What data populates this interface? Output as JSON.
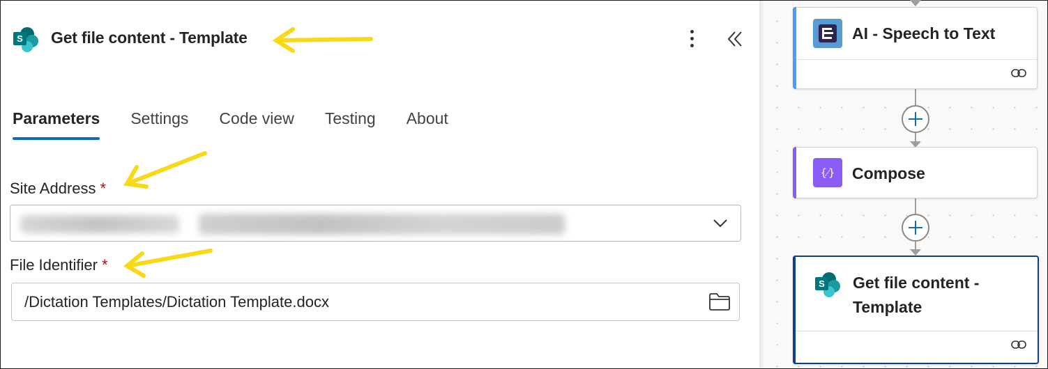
{
  "panel": {
    "title": "Get file content - Template",
    "icon": "sharepoint-icon",
    "more_icon": "more-vertical-icon",
    "collapse_icon": "double-chevron-left-icon"
  },
  "tabs": [
    {
      "label": "Parameters",
      "active": true
    },
    {
      "label": "Settings",
      "active": false
    },
    {
      "label": "Code view",
      "active": false
    },
    {
      "label": "Testing",
      "active": false
    },
    {
      "label": "About",
      "active": false
    }
  ],
  "fields": {
    "site_address": {
      "label": "Site Address",
      "required_mark": "*",
      "value": "",
      "value_blurred": true,
      "icon": "chevron-down-icon"
    },
    "file_identifier": {
      "label": "File Identifier",
      "required_mark": "*",
      "value": "/Dictation Templates/Dictation Template.docx",
      "icon": "folder-icon"
    }
  },
  "flow": {
    "cards": [
      {
        "title": "AI - Speech to Text",
        "icon": "ai-builder-icon",
        "accent": "#4a9ff5",
        "footer_icon": "link-icon"
      },
      {
        "title": "Compose",
        "icon": "compose-icon",
        "icon_text": "{⁄}",
        "accent": "#8b5cf6"
      },
      {
        "title_line1": "Get file content -",
        "title_line2": "Template",
        "icon": "sharepoint-icon",
        "accent": "#0f3f8c",
        "selected": true,
        "footer_icon": "link-icon"
      }
    ],
    "add_step_icon": "plus-icon"
  },
  "colors": {
    "tab_underline": "#0f6cbd",
    "required": "#b10e1c",
    "annotation_arrow": "#f7d917"
  }
}
